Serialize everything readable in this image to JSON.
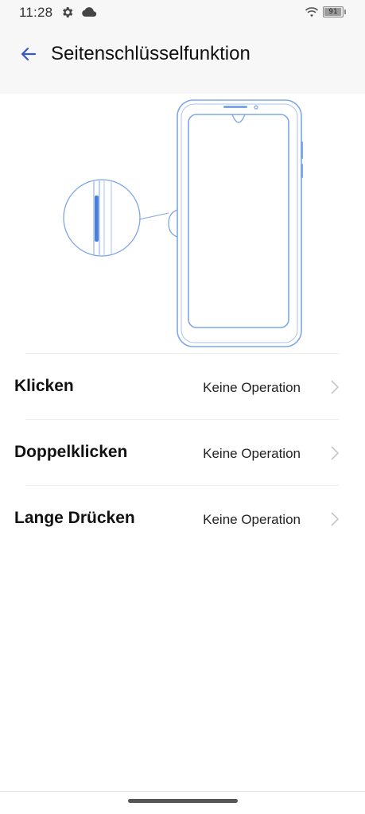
{
  "status_bar": {
    "time": "11:28",
    "battery_level": "91",
    "icons": [
      "gear-icon",
      "cloud-icon",
      "wifi-icon",
      "battery-icon"
    ]
  },
  "app_bar": {
    "title": "Seitenschlüsselfunktion",
    "back_icon": "arrow-left-icon"
  },
  "illustration": {
    "description_icon": "phone-side-key-illustration",
    "highlight_color": "#4a7fdc"
  },
  "settings": [
    {
      "label": "Klicken",
      "value": "Keine Operation"
    },
    {
      "label": "Doppelklicken",
      "value": "Keine Operation"
    },
    {
      "label": "Lange Drücken",
      "value": "Keine Operation"
    }
  ],
  "colors": {
    "accent": "#3a56c5",
    "phone_outline": "#7fa6e8",
    "chevron": "#c6c6c6"
  }
}
